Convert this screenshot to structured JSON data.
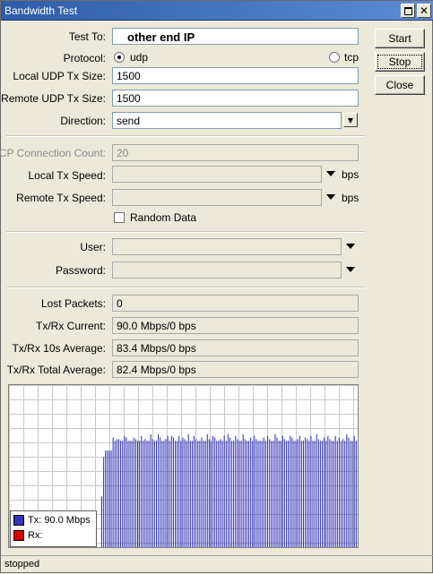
{
  "window": {
    "title": "Bandwidth Test"
  },
  "buttons": {
    "start": "Start",
    "stop": "Stop",
    "close": "Close"
  },
  "form": {
    "test_to": {
      "label": "Test To:",
      "value": "other end IP"
    },
    "protocol": {
      "label": "Protocol:",
      "options": [
        "udp",
        "tcp"
      ],
      "selected": "udp"
    },
    "local_udp_tx_size": {
      "label": "Local UDP Tx Size:",
      "value": "1500"
    },
    "remote_udp_tx_size": {
      "label": "Remote UDP Tx Size:",
      "value": "1500"
    },
    "direction": {
      "label": "Direction:",
      "value": "send"
    },
    "tcp_connection_count": {
      "label": "TCP Connection Count:",
      "value": "20"
    },
    "local_tx_speed": {
      "label": "Local Tx Speed:",
      "value": "",
      "unit": "bps"
    },
    "remote_tx_speed": {
      "label": "Remote Tx Speed:",
      "value": "",
      "unit": "bps"
    },
    "random_data": {
      "label": "Random Data",
      "checked": false
    },
    "user": {
      "label": "User:",
      "value": ""
    },
    "password": {
      "label": "Password:",
      "value": ""
    }
  },
  "stats": {
    "lost_packets": {
      "label": "Lost Packets:",
      "value": "0"
    },
    "txrx_current": {
      "label": "Tx/Rx Current:",
      "value": "90.0 Mbps/0 bps"
    },
    "txrx_10s_avg": {
      "label": "Tx/Rx 10s Average:",
      "value": "83.4 Mbps/0 bps"
    },
    "txrx_total_avg": {
      "label": "Tx/Rx Total Average:",
      "value": "82.4 Mbps/0 bps"
    }
  },
  "graph": {
    "legend": {
      "tx": "Tx:  90.0 Mbps",
      "rx": "Rx:"
    },
    "colors": {
      "tx": "#3333bb",
      "rx": "#dd0000",
      "grid": "#c8c8c8"
    },
    "tx_level_pct": [
      0,
      0,
      0,
      0,
      0,
      0,
      0,
      0,
      0,
      0,
      0,
      0,
      0,
      0,
      0,
      0,
      0,
      0,
      0,
      0,
      0,
      0,
      0,
      0,
      0,
      0,
      0,
      0,
      0,
      0,
      0,
      0,
      0,
      0,
      0,
      0,
      0,
      0,
      0,
      0,
      0,
      0,
      0,
      0,
      0,
      0,
      0,
      0,
      0,
      32,
      56,
      60,
      60,
      60,
      60,
      68,
      66,
      67,
      67,
      66,
      66,
      69,
      68,
      66,
      66,
      66,
      68,
      67,
      66,
      66,
      69,
      66,
      67,
      66,
      66,
      70,
      67,
      66,
      66,
      70,
      68,
      66,
      66,
      67,
      69,
      66,
      69,
      68,
      66,
      66,
      69,
      66,
      68,
      67,
      66,
      70,
      66,
      66,
      69,
      67,
      66,
      66,
      68,
      66,
      66,
      70,
      67,
      66,
      69,
      68,
      66,
      66,
      67,
      66,
      69,
      66,
      70,
      68,
      66,
      66,
      69,
      67,
      66,
      66,
      70,
      67,
      66,
      66,
      68,
      66,
      69,
      67,
      66,
      66,
      66,
      68,
      66,
      69,
      67,
      66,
      66,
      70,
      68,
      66,
      66,
      69,
      67,
      66,
      66,
      69,
      68,
      66,
      66,
      67,
      69,
      66,
      66,
      68,
      67,
      66,
      69,
      66,
      66,
      70,
      67,
      66,
      66,
      68,
      66,
      69,
      67,
      66,
      66,
      69,
      66,
      68,
      66,
      67,
      66,
      70,
      68,
      66,
      66,
      69,
      66,
      67
    ]
  },
  "status": {
    "text": "stopped"
  }
}
